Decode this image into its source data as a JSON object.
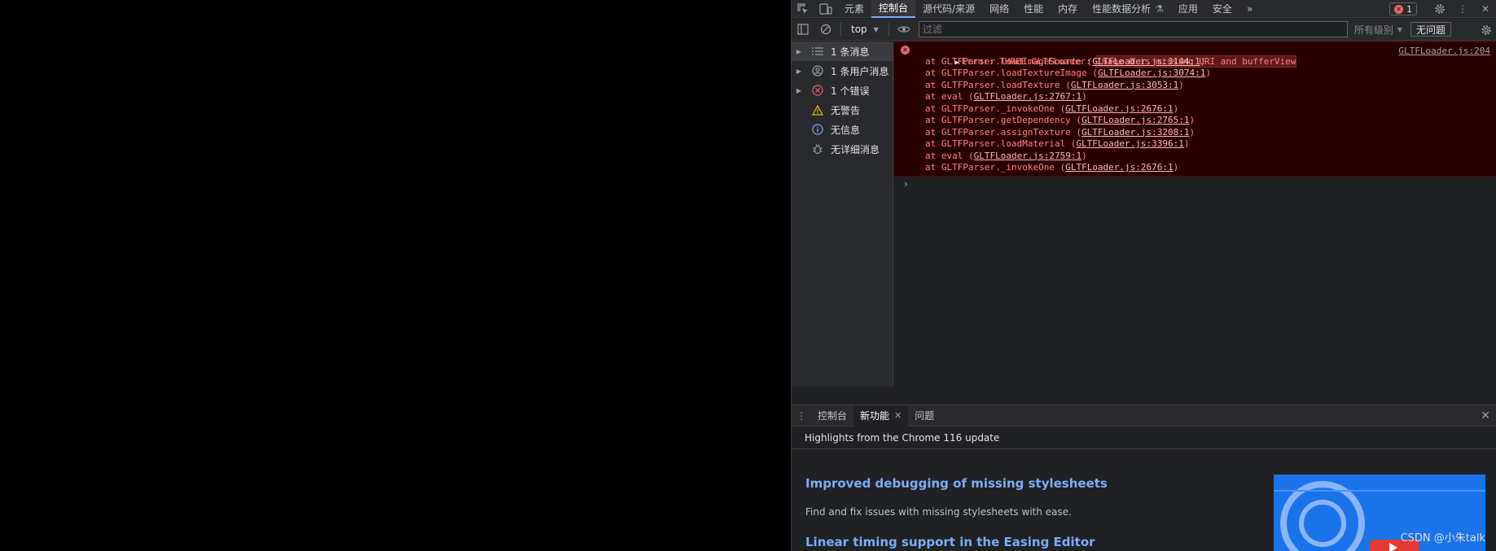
{
  "devtools": {
    "tabs": [
      {
        "label": "元素"
      },
      {
        "label": "控制台"
      },
      {
        "label": "源代码/来源"
      },
      {
        "label": "网络"
      },
      {
        "label": "性能"
      },
      {
        "label": "内存"
      },
      {
        "label": "性能数据分析"
      },
      {
        "label": "应用"
      },
      {
        "label": "安全"
      }
    ],
    "active_tab": "控制台",
    "error_count": "1",
    "more_tabs_icon": "chevron-double-right-icon"
  },
  "console_toolbar": {
    "context": "top",
    "filter_placeholder": "过滤",
    "levels_label": "所有级别",
    "issues_label": "无问题"
  },
  "sidebar": {
    "items": [
      {
        "label": "1 条消息",
        "icon": "list-icon",
        "expandable": true
      },
      {
        "label": "1 条用户消息",
        "icon": "user-icon",
        "expandable": true
      },
      {
        "label": "1 个错误",
        "icon": "error-icon",
        "expandable": true
      },
      {
        "label": "无警告",
        "icon": "warning-icon",
        "expandable": false
      },
      {
        "label": "无信息",
        "icon": "info-icon",
        "expandable": false
      },
      {
        "label": "无详细消息",
        "icon": "bug-icon",
        "expandable": false
      }
    ]
  },
  "error": {
    "prefix": "Error: THREE.GLTFLoader: ",
    "highlight": "Image 0 is missing URI and bufferView",
    "source": "GLTFLoader.js:204",
    "stack": [
      {
        "fn": "at GLTFParser.loadImageSource",
        "loc": "GLTFLoader.js:3144:1"
      },
      {
        "fn": "at GLTFParser.loadTextureImage",
        "loc": "GLTFLoader.js:3074:1"
      },
      {
        "fn": "at GLTFParser.loadTexture",
        "loc": "GLTFLoader.js:3053:1"
      },
      {
        "fn": "at eval",
        "loc": "GLTFLoader.js:2767:1"
      },
      {
        "fn": "at GLTFParser._invokeOne",
        "loc": "GLTFLoader.js:2676:1"
      },
      {
        "fn": "at GLTFParser.getDependency",
        "loc": "GLTFLoader.js:2765:1"
      },
      {
        "fn": "at GLTFParser.assignTexture",
        "loc": "GLTFLoader.js:3208:1"
      },
      {
        "fn": "at GLTFParser.loadMaterial",
        "loc": "GLTFLoader.js:3396:1"
      },
      {
        "fn": "at eval",
        "loc": "GLTFLoader.js:2759:1"
      },
      {
        "fn": "at GLTFParser._invokeOne",
        "loc": "GLTFLoader.js:2676:1"
      }
    ]
  },
  "drawer": {
    "tabs": [
      {
        "label": "控制台"
      },
      {
        "label": "新功能"
      },
      {
        "label": "问题"
      }
    ],
    "active_tab": "新功能",
    "subheader": "Highlights from the Chrome 116 update",
    "items": [
      {
        "title": "Improved debugging of missing stylesheets",
        "desc": "Find and fix issues with missing stylesheets with ease."
      },
      {
        "title": "Linear timing support in the Easing Editor",
        "desc": ""
      }
    ],
    "watermark": "CSDN @小朱talk"
  },
  "colors": {
    "accent": "#7cacf8",
    "error_bg": "#290000",
    "error_text": "#ff8080",
    "panel_bg": "#202124"
  }
}
